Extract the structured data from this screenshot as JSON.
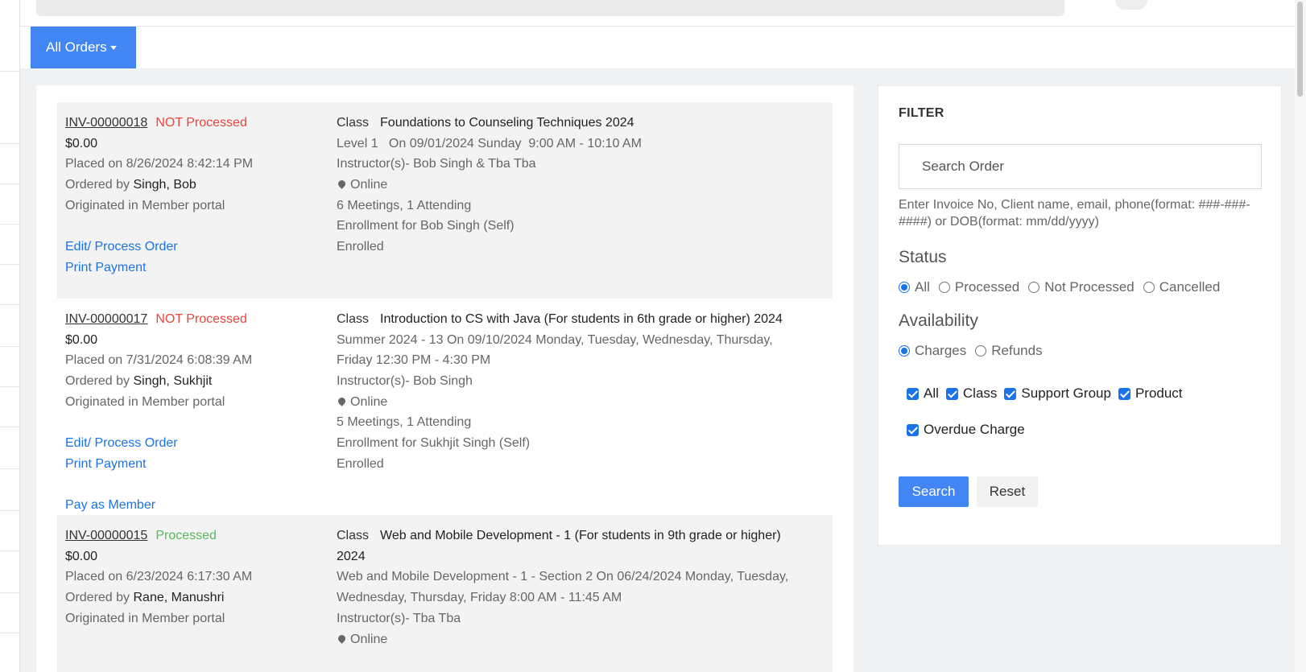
{
  "top": {
    "menu_label": "All Orders"
  },
  "orders": [
    {
      "invoice": "INV-00000018",
      "status": "NOT Processed",
      "amount": "$0.00",
      "placed": "Placed on 8/26/2024 8:42:14 PM",
      "ordered_by_label": "Ordered by",
      "ordered_by": "Singh, Bob",
      "origin": "Originated in Member portal",
      "edit_label": "Edit/ Process Order",
      "print_label": "Print Payment",
      "type": "Class",
      "title": "Foundations to Counseling Techniques 2024",
      "schedule": "Level 1   On 09/01/2024 Sunday  9:00 AM - 10:10 AM",
      "instructors": "Instructor(s)- Bob Singh & Tba Tba",
      "location": "Online",
      "meetings": "6 Meetings, 1 Attending",
      "enrollment": "Enrollment for Bob Singh (Self)",
      "enroll_status": "Enrolled"
    },
    {
      "invoice": "INV-00000017",
      "status": "NOT Processed",
      "amount": "$0.00",
      "placed": "Placed on 7/31/2024 6:08:39 AM",
      "ordered_by_label": "Ordered by",
      "ordered_by": "Singh, Sukhjit",
      "origin": "Originated in Member portal",
      "edit_label": "Edit/ Process Order",
      "print_label": "Print Payment",
      "pay_label": "Pay as Member",
      "type": "Class",
      "title": "Introduction to CS with Java (For students in 6th grade or higher) 2024",
      "schedule": "Summer 2024 - 13   On 09/10/2024 Monday, Tuesday, Wednesday, Thursday, Friday  12:30 PM - 4:30 PM",
      "instructors": "Instructor(s)- Bob Singh",
      "location": "Online",
      "meetings": "5 Meetings, 1 Attending",
      "enrollment": "Enrollment for Sukhjit Singh (Self)",
      "enroll_status": "Enrolled"
    },
    {
      "invoice": "INV-00000015",
      "status": "Processed",
      "amount": "$0.00",
      "placed": "Placed on 6/23/2024 6:17:30 AM",
      "ordered_by_label": "Ordered by",
      "ordered_by": "Rane, Manushri",
      "origin": "Originated in Member portal",
      "type": "Class",
      "title": "Web and Mobile Development - 1 (For students in 9th grade or higher) 2024",
      "schedule": "Web and Mobile Development - 1 - Section 2   On 06/24/2024 Monday, Tuesday, Wednesday, Thursday, Friday  8:00 AM - 11:45 AM",
      "instructors": "Instructor(s)- Tba Tba",
      "location": "Online"
    }
  ],
  "filter": {
    "title": "FILTER",
    "search_placeholder": "Search Order",
    "hint": "Enter Invoice No, Client name, email, phone(format: ###-###-####) or DOB(format: mm/dd/yyyy)",
    "status_heading": "Status",
    "status_options": [
      "All",
      "Processed",
      "Not Processed",
      "Cancelled"
    ],
    "status_selected": "All",
    "availability_heading": "Availability",
    "availability_options": [
      "Charges",
      "Refunds"
    ],
    "availability_selected": "Charges",
    "types": [
      "All",
      "Class",
      "Support Group",
      "Product",
      "Overdue Charge"
    ],
    "search_button": "Search",
    "reset_button": "Reset"
  },
  "colors": {
    "accent": "#4285f4",
    "link": "#1a73e8",
    "not_processed": "#e8453c",
    "processed": "#5cb85c"
  }
}
